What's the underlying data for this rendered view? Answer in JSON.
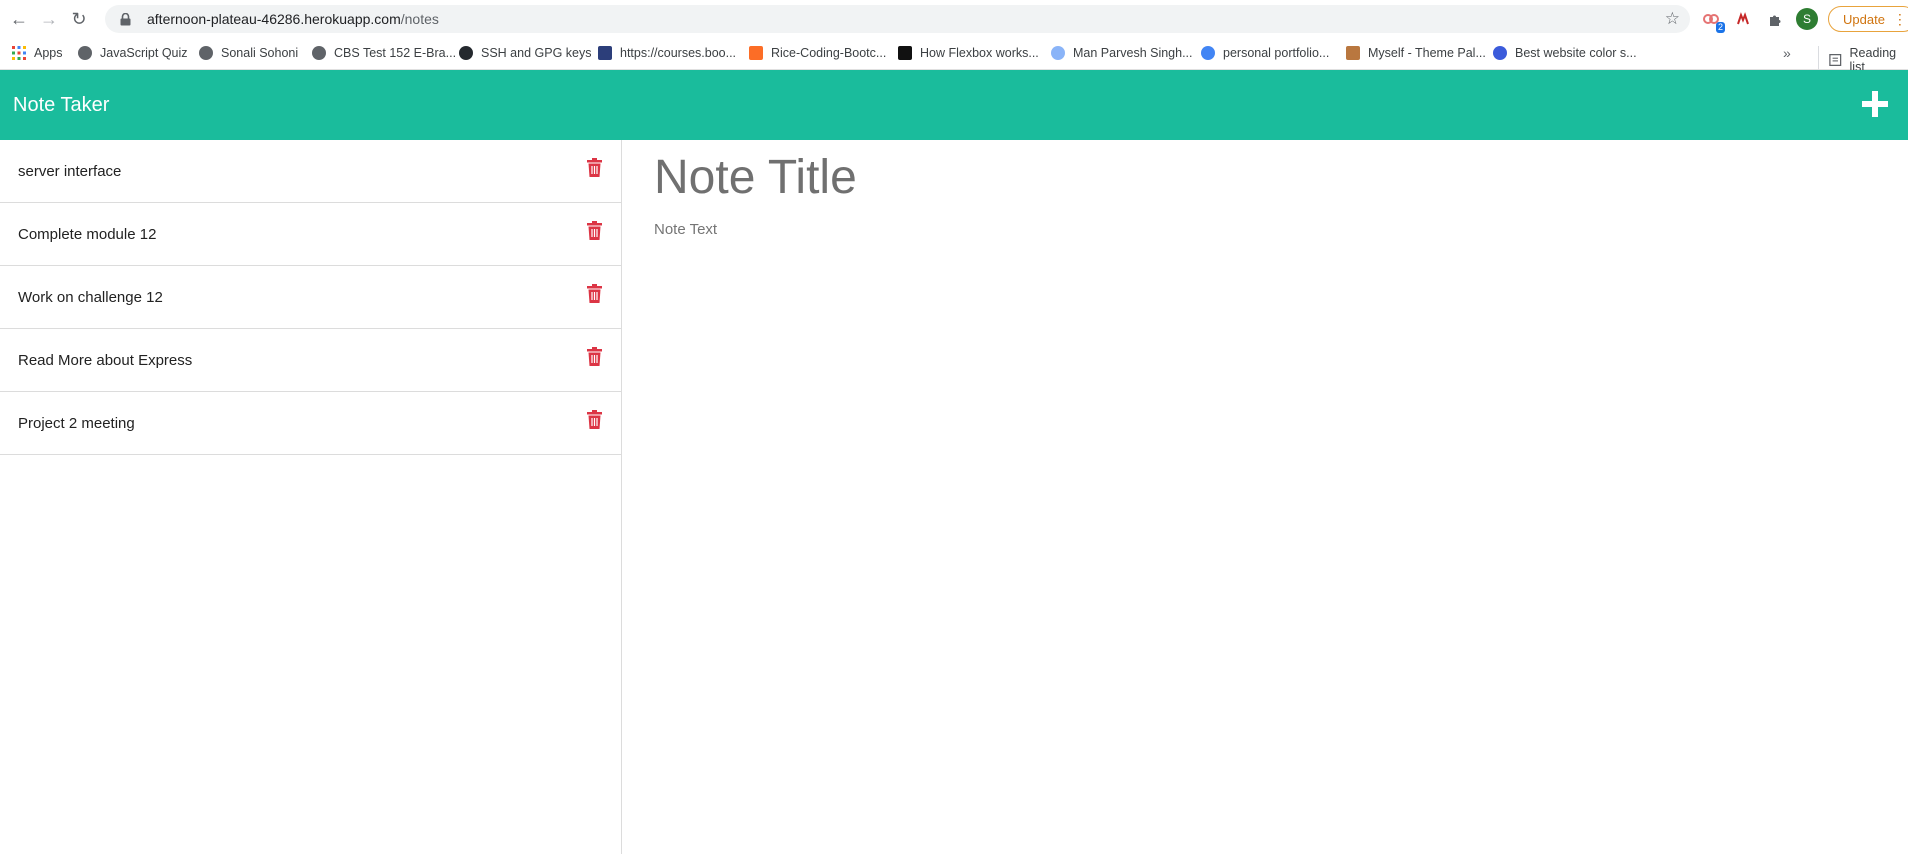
{
  "browser": {
    "url_host": "afternoon-plateau-46286.herokuapp.com",
    "url_path": "/notes",
    "extension_badge": "2",
    "profile_initial": "S",
    "update_label": "Update"
  },
  "bookmarks": [
    {
      "label": "Apps",
      "icon": "apps-grid-icon",
      "color": "#ea4335"
    },
    {
      "label": "JavaScript Quiz",
      "icon": "globe-icon",
      "color": "#5f6368"
    },
    {
      "label": "Sonali Sohoni",
      "icon": "globe-icon",
      "color": "#5f6368"
    },
    {
      "label": "CBS Test 152 E-Bra...",
      "icon": "globe-icon",
      "color": "#5f6368"
    },
    {
      "label": "SSH and GPG keys",
      "icon": "github-icon",
      "color": "#24292e"
    },
    {
      "label": "https://courses.boo...",
      "icon": "shield-icon",
      "color": "#2c3e7a"
    },
    {
      "label": "Rice-Coding-Bootc...",
      "icon": "gitlab-icon",
      "color": "#fc6d26"
    },
    {
      "label": "How Flexbox works...",
      "icon": "flexbox-icon",
      "color": "#111111"
    },
    {
      "label": "Man Parvesh Singh...",
      "icon": "avatar-icon",
      "color": "#8ab4f8"
    },
    {
      "label": "personal portfolio...",
      "icon": "google-icon",
      "color": "#4285f4"
    },
    {
      "label": "Myself - Theme Pal...",
      "icon": "p-logo-icon",
      "color": "#b9773f"
    },
    {
      "label": "Best website color s...",
      "icon": "c-logo-icon",
      "color": "#3b5bdb"
    }
  ],
  "reading_list_label": "Reading list",
  "app": {
    "title": "Note Taker",
    "accent_color": "#1abc9c",
    "delete_color": "#dc3545"
  },
  "notes": [
    {
      "title": "server interface"
    },
    {
      "title": "Complete module 12"
    },
    {
      "title": "Work on challenge 12"
    },
    {
      "title": "Read More about Express"
    },
    {
      "title": "Project 2 meeting"
    }
  ],
  "editor": {
    "title_placeholder": "Note Title",
    "text_placeholder": "Note Text"
  }
}
